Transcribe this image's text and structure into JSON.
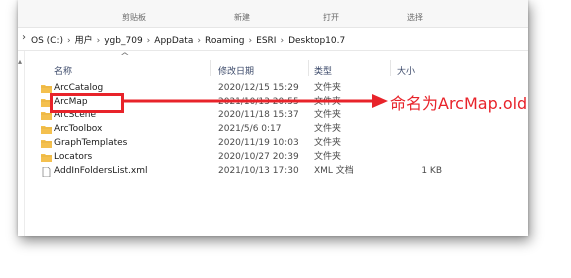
{
  "ribbon": {
    "labels": [
      "剪贴板",
      "新建",
      "打开",
      "选择"
    ]
  },
  "address": {
    "crumbs": [
      "OS (C:)",
      "用户",
      "ygb_709",
      "AppData",
      "Roaming",
      "ESRI",
      "Desktop10.7"
    ],
    "separator": "›"
  },
  "columns": {
    "name": "名称",
    "date": "修改日期",
    "type": "类型",
    "size": "大小"
  },
  "files": [
    {
      "name": "ArcCatalog",
      "date": "2020/12/15 15:29",
      "type": "文件夹",
      "size": "",
      "icon": "folder-icon"
    },
    {
      "name": "ArcMap",
      "date": "2021/10/13 20:55",
      "type": "文件夹",
      "size": "",
      "icon": "folder-icon"
    },
    {
      "name": "ArcScene",
      "date": "2020/11/18 15:37",
      "type": "文件夹",
      "size": "",
      "icon": "folder-icon"
    },
    {
      "name": "ArcToolbox",
      "date": "2021/5/6 0:17",
      "type": "文件夹",
      "size": "",
      "icon": "folder-icon"
    },
    {
      "name": "GraphTemplates",
      "date": "2020/11/19 10:03",
      "type": "文件夹",
      "size": "",
      "icon": "folder-icon"
    },
    {
      "name": "Locators",
      "date": "2020/10/27 20:39",
      "type": "文件夹",
      "size": "",
      "icon": "folder-icon"
    },
    {
      "name": "AddInFoldersList.xml",
      "date": "2021/10/13 17:30",
      "type": "XML 文档",
      "size": "1 KB",
      "icon": "document-icon"
    }
  ],
  "annotation": {
    "text": "命名为ArcMap.old",
    "color": "#e8232a",
    "highlighted_item": "ArcMap"
  },
  "colors": {
    "folder": "#f4c04e",
    "accent": "#e8232a"
  }
}
